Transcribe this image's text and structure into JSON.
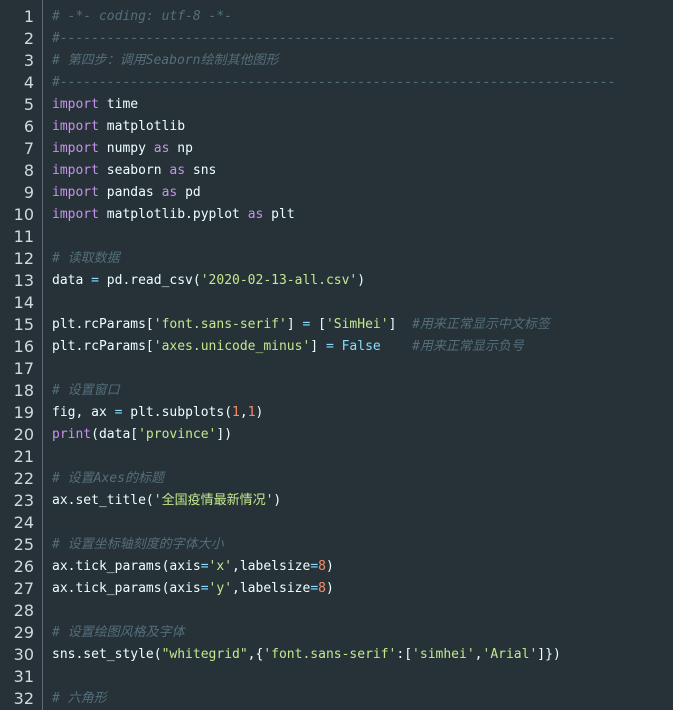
{
  "theme": {
    "background": "#263238",
    "comment": "#546e7a",
    "keyword": "#c792ea",
    "string": "#c3e88d",
    "number": "#f78c6c",
    "constant": "#89ddff",
    "plain": "#eeffff",
    "line_number": "#cfd8dc"
  },
  "lines": [
    {
      "n": "1",
      "tokens": [
        {
          "t": "comment",
          "v": "# -*- coding: utf-8 -*-"
        }
      ]
    },
    {
      "n": "2",
      "tokens": [
        {
          "t": "comment",
          "v": "#-----------------------------------------------------------------------"
        }
      ]
    },
    {
      "n": "3",
      "tokens": [
        {
          "t": "comment",
          "v": "# 第四步：调用Seaborn绘制其他图形"
        }
      ]
    },
    {
      "n": "4",
      "tokens": [
        {
          "t": "comment",
          "v": "#-----------------------------------------------------------------------"
        }
      ]
    },
    {
      "n": "5",
      "tokens": [
        {
          "t": "keyword",
          "v": "import"
        },
        {
          "t": "plain",
          "v": " time"
        }
      ]
    },
    {
      "n": "6",
      "tokens": [
        {
          "t": "keyword",
          "v": "import"
        },
        {
          "t": "plain",
          "v": " matplotlib"
        }
      ]
    },
    {
      "n": "7",
      "tokens": [
        {
          "t": "keyword",
          "v": "import"
        },
        {
          "t": "plain",
          "v": " numpy "
        },
        {
          "t": "keyword",
          "v": "as"
        },
        {
          "t": "plain",
          "v": " np"
        }
      ]
    },
    {
      "n": "8",
      "tokens": [
        {
          "t": "keyword",
          "v": "import"
        },
        {
          "t": "plain",
          "v": " seaborn "
        },
        {
          "t": "keyword",
          "v": "as"
        },
        {
          "t": "plain",
          "v": " sns"
        }
      ]
    },
    {
      "n": "9",
      "tokens": [
        {
          "t": "keyword",
          "v": "import"
        },
        {
          "t": "plain",
          "v": " pandas "
        },
        {
          "t": "keyword",
          "v": "as"
        },
        {
          "t": "plain",
          "v": " pd"
        }
      ]
    },
    {
      "n": "10",
      "tokens": [
        {
          "t": "keyword",
          "v": "import"
        },
        {
          "t": "plain",
          "v": " matplotlib.pyplot "
        },
        {
          "t": "keyword",
          "v": "as"
        },
        {
          "t": "plain",
          "v": " plt"
        }
      ]
    },
    {
      "n": "11",
      "tokens": []
    },
    {
      "n": "12",
      "tokens": [
        {
          "t": "comment",
          "v": "# 读取数据"
        }
      ]
    },
    {
      "n": "13",
      "tokens": [
        {
          "t": "plain",
          "v": "data "
        },
        {
          "t": "operator",
          "v": "="
        },
        {
          "t": "plain",
          "v": " pd.read_csv("
        },
        {
          "t": "string",
          "v": "'2020-02-13-all.csv'"
        },
        {
          "t": "plain",
          "v": ")"
        }
      ]
    },
    {
      "n": "14",
      "tokens": []
    },
    {
      "n": "15",
      "tokens": [
        {
          "t": "plain",
          "v": "plt.rcParams["
        },
        {
          "t": "string",
          "v": "'font.sans-serif'"
        },
        {
          "t": "plain",
          "v": "] "
        },
        {
          "t": "operator",
          "v": "="
        },
        {
          "t": "plain",
          "v": " ["
        },
        {
          "t": "string",
          "v": "'SimHei'"
        },
        {
          "t": "plain",
          "v": "]  "
        },
        {
          "t": "comment",
          "v": "#用来正常显示中文标签"
        }
      ]
    },
    {
      "n": "16",
      "tokens": [
        {
          "t": "plain",
          "v": "plt.rcParams["
        },
        {
          "t": "string",
          "v": "'axes.unicode_minus'"
        },
        {
          "t": "plain",
          "v": "] "
        },
        {
          "t": "operator",
          "v": "="
        },
        {
          "t": "plain",
          "v": " "
        },
        {
          "t": "constant",
          "v": "False"
        },
        {
          "t": "plain",
          "v": "    "
        },
        {
          "t": "comment",
          "v": "#用来正常显示负号"
        }
      ]
    },
    {
      "n": "17",
      "tokens": []
    },
    {
      "n": "18",
      "tokens": [
        {
          "t": "comment",
          "v": "# 设置窗口"
        }
      ]
    },
    {
      "n": "19",
      "tokens": [
        {
          "t": "plain",
          "v": "fig, ax "
        },
        {
          "t": "operator",
          "v": "="
        },
        {
          "t": "plain",
          "v": " plt.subplots("
        },
        {
          "t": "number",
          "v": "1"
        },
        {
          "t": "plain",
          "v": ","
        },
        {
          "t": "number",
          "v": "1"
        },
        {
          "t": "plain",
          "v": ")"
        }
      ]
    },
    {
      "n": "20",
      "tokens": [
        {
          "t": "keyword",
          "v": "print"
        },
        {
          "t": "plain",
          "v": "(data["
        },
        {
          "t": "string",
          "v": "'province'"
        },
        {
          "t": "plain",
          "v": "])"
        }
      ]
    },
    {
      "n": "21",
      "tokens": []
    },
    {
      "n": "22",
      "tokens": [
        {
          "t": "comment",
          "v": "# 设置Axes的标题"
        }
      ]
    },
    {
      "n": "23",
      "tokens": [
        {
          "t": "plain",
          "v": "ax.set_title("
        },
        {
          "t": "string",
          "v": "'全国疫情最新情况'"
        },
        {
          "t": "plain",
          "v": ")"
        }
      ]
    },
    {
      "n": "24",
      "tokens": []
    },
    {
      "n": "25",
      "tokens": [
        {
          "t": "comment",
          "v": "# 设置坐标轴刻度的字体大小"
        }
      ]
    },
    {
      "n": "26",
      "tokens": [
        {
          "t": "plain",
          "v": "ax.tick_params(axis"
        },
        {
          "t": "operator",
          "v": "="
        },
        {
          "t": "string",
          "v": "'x'"
        },
        {
          "t": "plain",
          "v": ",labelsize"
        },
        {
          "t": "operator",
          "v": "="
        },
        {
          "t": "number",
          "v": "8"
        },
        {
          "t": "plain",
          "v": ")"
        }
      ]
    },
    {
      "n": "27",
      "tokens": [
        {
          "t": "plain",
          "v": "ax.tick_params(axis"
        },
        {
          "t": "operator",
          "v": "="
        },
        {
          "t": "string",
          "v": "'y'"
        },
        {
          "t": "plain",
          "v": ",labelsize"
        },
        {
          "t": "operator",
          "v": "="
        },
        {
          "t": "number",
          "v": "8"
        },
        {
          "t": "plain",
          "v": ")"
        }
      ]
    },
    {
      "n": "28",
      "tokens": []
    },
    {
      "n": "29",
      "tokens": [
        {
          "t": "comment",
          "v": "# 设置绘图风格及字体"
        }
      ]
    },
    {
      "n": "30",
      "tokens": [
        {
          "t": "plain",
          "v": "sns.set_style("
        },
        {
          "t": "string",
          "v": "\"whitegrid\""
        },
        {
          "t": "plain",
          "v": ",{"
        },
        {
          "t": "string",
          "v": "'font.sans-serif'"
        },
        {
          "t": "plain",
          "v": ":["
        },
        {
          "t": "string",
          "v": "'simhei'"
        },
        {
          "t": "plain",
          "v": ","
        },
        {
          "t": "string",
          "v": "'Arial'"
        },
        {
          "t": "plain",
          "v": "]})"
        }
      ]
    },
    {
      "n": "31",
      "tokens": []
    },
    {
      "n": "32",
      "tokens": [
        {
          "t": "comment",
          "v": "# 六角形"
        }
      ]
    }
  ]
}
